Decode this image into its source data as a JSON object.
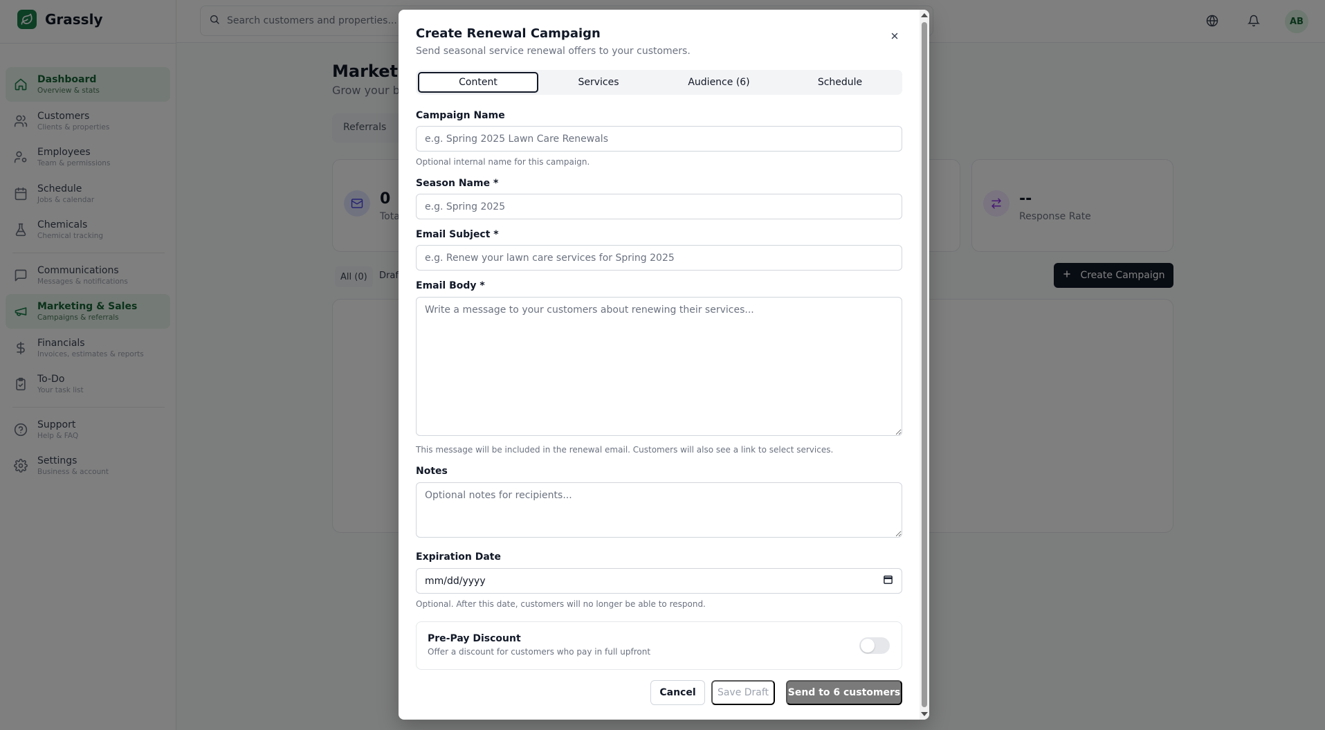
{
  "app": {
    "name": "Grassly",
    "search_placeholder": "Search customers and properties...",
    "user_initials": "AB"
  },
  "sidebar": {
    "items": [
      {
        "label": "Dashboard",
        "sub": "Overview & stats",
        "icon": "home-icon",
        "active": true
      },
      {
        "label": "Customers",
        "sub": "Clients & properties",
        "icon": "users-icon",
        "active": false
      },
      {
        "label": "Employees",
        "sub": "Team & permissions",
        "icon": "user-cog-icon",
        "active": false
      },
      {
        "label": "Schedule",
        "sub": "Jobs & calendar",
        "icon": "calendar-icon",
        "active": false
      },
      {
        "label": "Chemicals",
        "sub": "Chemical tracking",
        "icon": "flask-icon",
        "active": false
      },
      {
        "label": "Communications",
        "sub": "Messages & notifications",
        "icon": "message-icon",
        "active": false
      },
      {
        "label": "Marketing & Sales",
        "sub": "Campaigns & referrals",
        "icon": "megaphone-icon",
        "active": true
      },
      {
        "label": "Financials",
        "sub": "Invoices, estimates & reports",
        "icon": "dollar-icon",
        "active": false
      },
      {
        "label": "To-Do",
        "sub": "Your task list",
        "icon": "clipboard-icon",
        "active": false
      },
      {
        "label": "Support",
        "sub": "Help & FAQ",
        "icon": "help-icon",
        "active": false
      },
      {
        "label": "Settings",
        "sub": "Business & account",
        "icon": "gear-icon",
        "active": false
      }
    ]
  },
  "background_page": {
    "title": "Marketin",
    "subtitle": "Grow your bu",
    "tab_label": "Referrals",
    "stat_total_value": "0",
    "stat_total_label": "Tota",
    "stat_response_value": "--",
    "stat_response_label": "Response Rate",
    "filter_all": "All (0)",
    "filter_draft": "Draf",
    "create_button": "Create Campaign"
  },
  "modal": {
    "title": "Create Renewal Campaign",
    "description": "Send seasonal service renewal offers to your customers.",
    "tabs": [
      {
        "label": "Content",
        "active": true
      },
      {
        "label": "Services",
        "active": false
      },
      {
        "label": "Audience (6)",
        "active": false
      },
      {
        "label": "Schedule",
        "active": false
      }
    ],
    "campaign_name": {
      "label": "Campaign Name",
      "placeholder": "e.g. Spring 2025 Lawn Care Renewals",
      "value": "",
      "help": "Optional internal name for this campaign."
    },
    "season_name": {
      "label": "Season Name *",
      "placeholder": "e.g. Spring 2025",
      "value": ""
    },
    "email_subject": {
      "label": "Email Subject *",
      "placeholder": "e.g. Renew your lawn care services for Spring 2025",
      "value": ""
    },
    "email_body": {
      "label": "Email Body *",
      "placeholder": "Write a message to your customers about renewing their services...",
      "value": "",
      "help": "This message will be included in the renewal email. Customers will also see a link to select services."
    },
    "notes": {
      "label": "Notes",
      "placeholder": "Optional notes for recipients...",
      "value": ""
    },
    "expiration_date": {
      "label": "Expiration Date",
      "display": "mm/dd/yyyy",
      "help": "Optional. After this date, customers will no longer be able to respond."
    },
    "prepay_discount": {
      "title": "Pre-Pay Discount",
      "subtitle": "Offer a discount for customers who pay in full upfront",
      "enabled": false
    },
    "buttons": {
      "cancel": "Cancel",
      "save_draft": "Save Draft",
      "send": "Send to 6 customers"
    }
  },
  "colors": {
    "brand": "#1a7f4b",
    "active_nav_bg": "#e8f5ec",
    "overlay": "rgba(0,0,0,0.5)",
    "send_button": "#7a7a7a"
  }
}
